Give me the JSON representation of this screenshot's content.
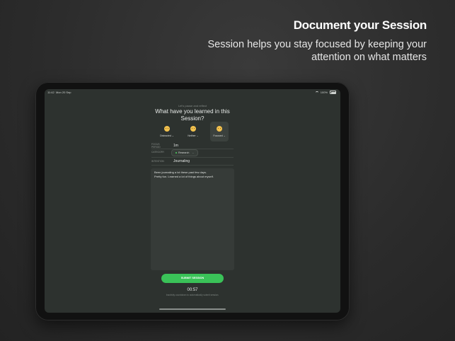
{
  "marketing": {
    "headline": "Document your Session",
    "subline": "Session helps you stay focused by keeping your attention on what matters"
  },
  "status_bar": {
    "time": "11:42",
    "date": "Mon 20 Sep",
    "battery": "100%"
  },
  "session_form": {
    "prompt": "Let's pause and reflect",
    "question": "What have you learned in this Session?",
    "moods": [
      {
        "label": "Distracted ⌄",
        "icon": "neutral-face-emoji",
        "selected": false
      },
      {
        "label": "Neither ⌄",
        "icon": "neutral-face-emoji",
        "selected": false
      },
      {
        "label": "Focused ⌄",
        "icon": "smiling-face-emoji",
        "selected": true
      }
    ],
    "fields": {
      "focus_period_label": "FOCUS PERIOD",
      "focus_period_value": "1m",
      "category_label": "CATEGORY",
      "category_value": "Research",
      "intention_label": "INTENTION",
      "intention_value": "Journaling"
    },
    "notes": "Been journaling a lot these past few days.\nPretty fun. Learned a lot of things about myself.",
    "submit_label": "SUBMIT SESSION",
    "timer": "00:57",
    "timer_note": "Inactivity countdown to automatically submit session."
  },
  "colors": {
    "accent": "#3ac258",
    "screen_background": "#2d322f",
    "page_background": "#2b2b2b"
  }
}
